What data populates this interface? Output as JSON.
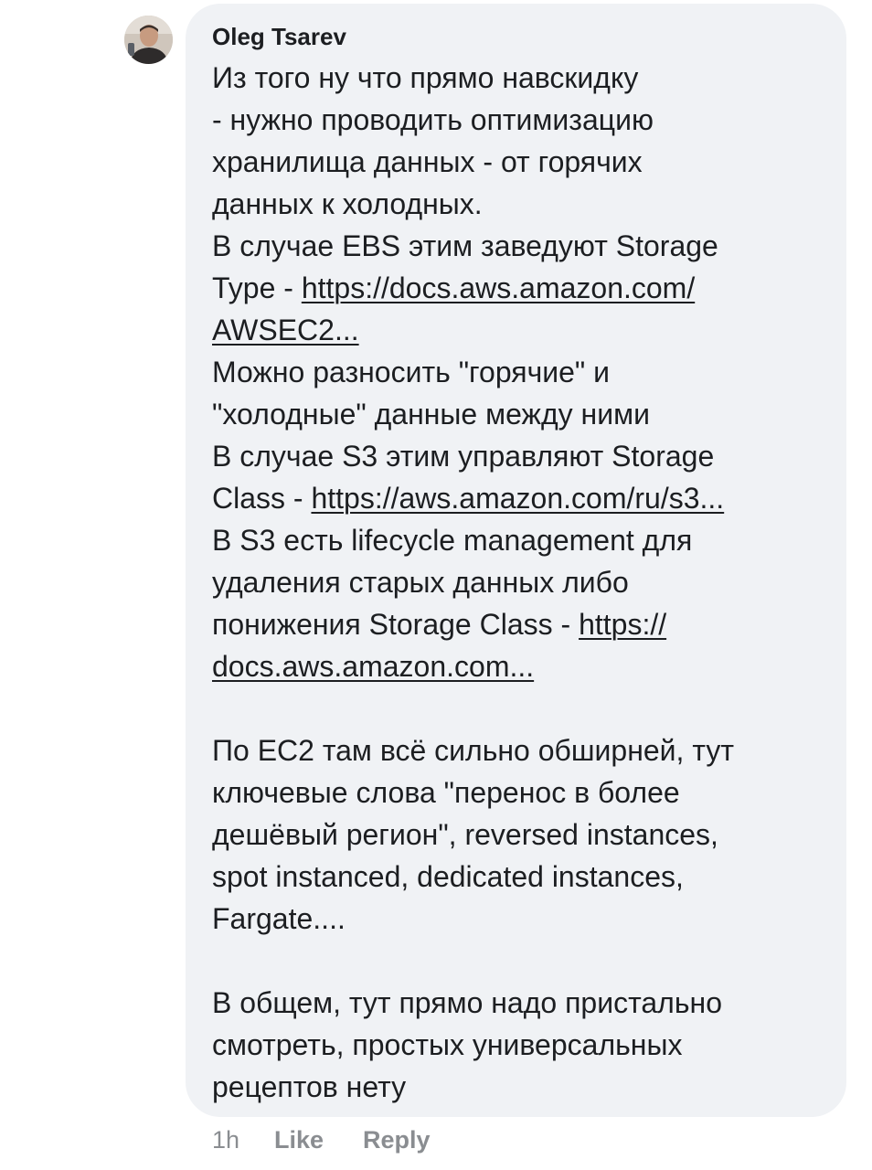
{
  "comment": {
    "author": "Oleg Tsarev",
    "lines": [
      [
        "Из того ну что прямо навскидку"
      ],
      [
        "- нужно проводить оптимизацию"
      ],
      [
        "хранилища данных - от горячих"
      ],
      [
        "данных к холодных."
      ],
      [
        "В случае EBS этим заведуют Storage"
      ],
      [
        "Type - "
      ],
      [
        ""
      ],
      [
        "Можно разносить \"горячие\" и"
      ],
      [
        "\"холодные\" данные между ними"
      ],
      [
        "В случае S3 этим управляют Storage"
      ],
      [
        "Class - "
      ],
      [
        "В S3 есть lifecycle management для"
      ],
      [
        "удаления старых данных либо"
      ],
      [
        "понижения Storage Class  - "
      ],
      [
        ""
      ],
      [
        ""
      ],
      [
        "По EC2 там всё сильно обширней, тут"
      ],
      [
        "ключевые слова \"перенос в более"
      ],
      [
        "дешёвый регион\", reversed instances,"
      ],
      [
        "spot instanced, dedicated instances,"
      ],
      [
        "Fargate...."
      ],
      [
        ""
      ],
      [
        "В общем, тут прямо надо пристально"
      ],
      [
        "смотреть, простых универсальных"
      ],
      [
        "рецептов нету"
      ]
    ],
    "links": {
      "ebs_part1": "https://docs.aws.amazon.com/",
      "ebs_part2": "AWSEC2...",
      "s3_class": "https://aws.amazon.com/ru/s3...",
      "lifecycle_part1": "https://",
      "lifecycle_part2": "docs.aws.amazon.com..."
    }
  },
  "meta": {
    "time": "1h",
    "like_label": "Like",
    "reply_label": "Reply"
  },
  "colors": {
    "bubble_bg": "#f0f2f5",
    "text": "#1c1e21",
    "meta_text": "#8a8d91"
  },
  "icons": {
    "avatar": "user-avatar-photo"
  }
}
